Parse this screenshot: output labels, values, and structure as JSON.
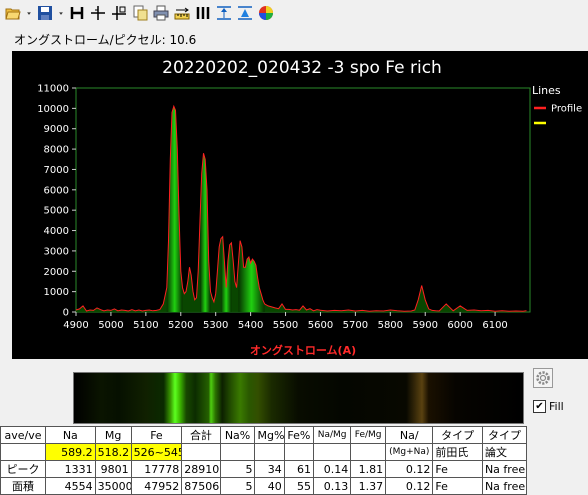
{
  "toolbar": {
    "buttons": [
      {
        "name": "open-folder-icon"
      },
      {
        "name": "dropdown-arrow-icon"
      },
      {
        "name": "save-icon"
      },
      {
        "name": "dropdown-arrow-icon"
      },
      {
        "name": "h-marker-icon"
      },
      {
        "name": "cross-cursor-icon"
      },
      {
        "name": "cross-split-icon"
      },
      {
        "name": "copy-icon"
      },
      {
        "name": "print-icon"
      },
      {
        "name": "ruler-icon"
      },
      {
        "name": "vertical-lines-icon"
      },
      {
        "name": "peak-marker-icon"
      },
      {
        "name": "fit-icon"
      },
      {
        "name": "color-wheel-icon"
      }
    ]
  },
  "scale_label": "オングストローム/ピクセル: 10.6",
  "chart_data": {
    "type": "area",
    "title": "20220202_020432 -3 spo Fe rich",
    "xlabel": "オングストローム(A)",
    "ylabel": "",
    "xlim": [
      4900,
      6200
    ],
    "ylim": [
      0,
      11000
    ],
    "xticks": [
      4900,
      5000,
      5100,
      5200,
      5300,
      5400,
      5500,
      5600,
      5700,
      5800,
      5900,
      6000,
      6100
    ],
    "yticks": [
      0,
      1000,
      2000,
      3000,
      4000,
      5000,
      6000,
      7000,
      8000,
      9000,
      10000,
      11000
    ],
    "grid": false,
    "legend": {
      "title": "Lines",
      "placement": "right",
      "entries": [
        {
          "name": "Profile",
          "color": "#ff2020"
        },
        {
          "name": "",
          "color": "#ffff00"
        }
      ]
    },
    "series": [
      {
        "name": "Profile",
        "color": "#ff2020",
        "fill": "#00cc00",
        "x": [
          4900,
          4910,
          4920,
          4930,
          4940,
          4950,
          4960,
          4970,
          4980,
          4990,
          5000,
          5010,
          5020,
          5030,
          5040,
          5050,
          5060,
          5070,
          5080,
          5090,
          5100,
          5110,
          5120,
          5130,
          5140,
          5150,
          5160,
          5165,
          5170,
          5175,
          5180,
          5185,
          5190,
          5195,
          5200,
          5205,
          5210,
          5215,
          5220,
          5225,
          5230,
          5235,
          5240,
          5245,
          5250,
          5255,
          5260,
          5265,
          5270,
          5275,
          5280,
          5285,
          5290,
          5295,
          5300,
          5305,
          5310,
          5315,
          5320,
          5325,
          5330,
          5335,
          5340,
          5345,
          5350,
          5355,
          5360,
          5365,
          5370,
          5375,
          5380,
          5385,
          5390,
          5395,
          5400,
          5405,
          5410,
          5415,
          5420,
          5425,
          5430,
          5435,
          5440,
          5450,
          5460,
          5470,
          5480,
          5490,
          5500,
          5510,
          5520,
          5530,
          5540,
          5550,
          5560,
          5570,
          5580,
          5590,
          5600,
          5620,
          5640,
          5660,
          5680,
          5700,
          5720,
          5740,
          5760,
          5780,
          5800,
          5820,
          5840,
          5860,
          5870,
          5880,
          5890,
          5900,
          5910,
          5920,
          5930,
          5940,
          5960,
          5980,
          6000,
          6020,
          6040,
          6060,
          6080,
          6100,
          6120,
          6140,
          6160,
          6180,
          6190
        ],
        "values": [
          100,
          150,
          300,
          50,
          100,
          80,
          200,
          120,
          60,
          100,
          80,
          150,
          60,
          100,
          80,
          50,
          120,
          60,
          100,
          50,
          80,
          100,
          60,
          80,
          120,
          400,
          1200,
          3500,
          7500,
          9800,
          10100,
          9900,
          8000,
          4800,
          2000,
          1200,
          900,
          1000,
          1500,
          2200,
          1800,
          1000,
          600,
          700,
          2000,
          4500,
          6800,
          7800,
          7500,
          6000,
          2500,
          1000,
          700,
          500,
          900,
          2000,
          3200,
          3600,
          3700,
          2500,
          1200,
          2500,
          3300,
          3400,
          2500,
          1500,
          1200,
          2400,
          3500,
          3200,
          2200,
          2200,
          2600,
          2700,
          2400,
          2600,
          2500,
          2300,
          1700,
          1200,
          900,
          600,
          400,
          300,
          250,
          200,
          160,
          400,
          130,
          130,
          100,
          120,
          90,
          300,
          100,
          160,
          60,
          120,
          90,
          50,
          80,
          60,
          100,
          50,
          80,
          40,
          60,
          50,
          100,
          60,
          40,
          50,
          100,
          600,
          1300,
          600,
          150,
          80,
          60,
          50,
          400,
          60,
          300,
          80,
          100,
          60,
          80,
          40,
          60,
          40,
          50,
          40,
          60
        ]
      }
    ]
  },
  "spectrum_bands": [
    {
      "pos": 0.0,
      "color": "#000000"
    },
    {
      "pos": 0.06,
      "color": "#0a1400"
    },
    {
      "pos": 0.1,
      "color": "#061000"
    },
    {
      "pos": 0.16,
      "color": "#102000"
    },
    {
      "pos": 0.2,
      "color": "#0a2a00"
    },
    {
      "pos": 0.215,
      "color": "#3a9a00"
    },
    {
      "pos": 0.225,
      "color": "#5cff20"
    },
    {
      "pos": 0.235,
      "color": "#40c000"
    },
    {
      "pos": 0.25,
      "color": "#184800"
    },
    {
      "pos": 0.27,
      "color": "#0c2c00"
    },
    {
      "pos": 0.3,
      "color": "#256000"
    },
    {
      "pos": 0.305,
      "color": "#4ecf10"
    },
    {
      "pos": 0.315,
      "color": "#2a7000"
    },
    {
      "pos": 0.33,
      "color": "#0c2000"
    },
    {
      "pos": 0.35,
      "color": "#245000"
    },
    {
      "pos": 0.37,
      "color": "#3a7a00"
    },
    {
      "pos": 0.39,
      "color": "#2a5800"
    },
    {
      "pos": 0.41,
      "color": "#334e00"
    },
    {
      "pos": 0.44,
      "color": "#1a2a00"
    },
    {
      "pos": 0.5,
      "color": "#080c00"
    },
    {
      "pos": 0.6,
      "color": "#040600"
    },
    {
      "pos": 0.74,
      "color": "#080800"
    },
    {
      "pos": 0.775,
      "color": "#5a4210"
    },
    {
      "pos": 0.79,
      "color": "#1a1000"
    },
    {
      "pos": 0.85,
      "color": "#060400"
    },
    {
      "pos": 1.0,
      "color": "#000000"
    }
  ],
  "table": {
    "rows": [
      [
        "ave/ve",
        "Na",
        "Mg",
        "Fe",
        "合計",
        "Na%",
        "Mg%",
        "Fe%",
        "Na/Mg",
        "Fe/Mg",
        "Na/",
        "タイプ",
        "タイプ"
      ],
      [
        "",
        "589.2",
        "518.2",
        "526~545",
        "",
        "",
        "",
        "",
        "",
        "",
        "(Mg+Na)",
        "前田氏",
        "論文"
      ],
      [
        "ピーク",
        "1331",
        "9801",
        "17778",
        "28910",
        "5",
        "34",
        "61",
        "0.14",
        "1.81",
        "0.12",
        "Fe",
        "Na free"
      ],
      [
        "面積",
        "4554",
        "35000",
        "47952",
        "87506",
        "5",
        "40",
        "55",
        "0.13",
        "1.37",
        "0.12",
        "Fe",
        "Na free"
      ]
    ]
  },
  "fill_checkbox": {
    "label": "Fill",
    "checked": true
  }
}
